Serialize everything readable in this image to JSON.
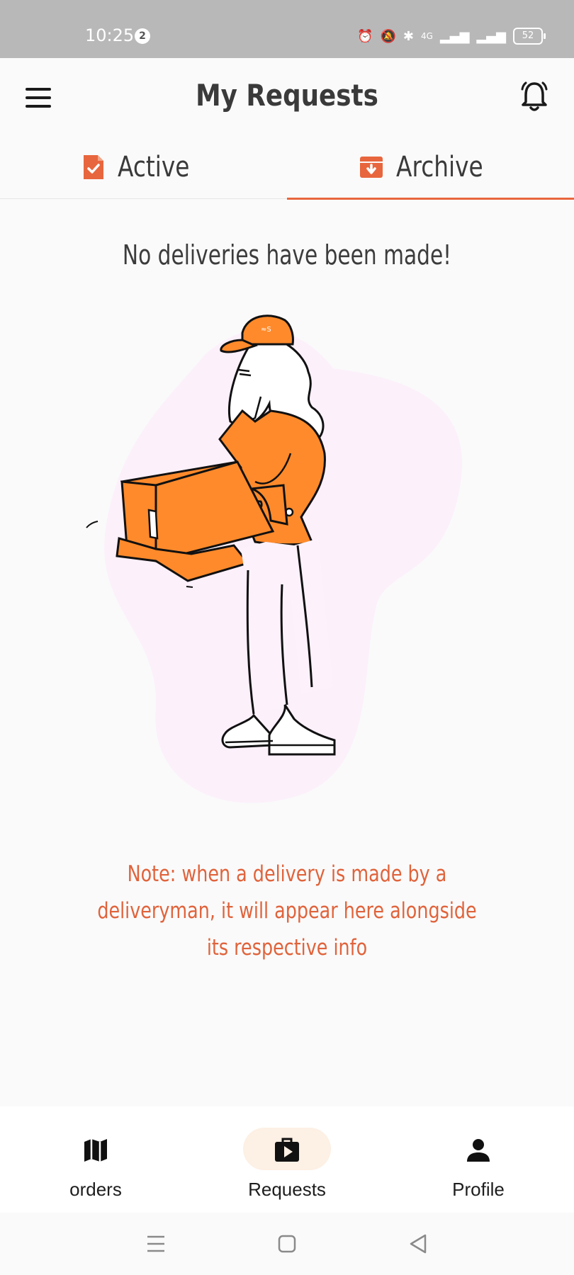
{
  "status_bar": {
    "time": "10:25",
    "notification_count": "2",
    "network": "4G",
    "battery": "52"
  },
  "header": {
    "title": "My Requests"
  },
  "tabs": [
    {
      "label": "Active",
      "selected": false
    },
    {
      "label": "Archive",
      "selected": true
    }
  ],
  "content": {
    "empty_message": "No deliveries have been made!",
    "note": "Note: when a delivery is made by a deliveryman, it will appear here alongside its respective info"
  },
  "bottom_nav": {
    "items": [
      {
        "label": "orders",
        "icon": "map-icon"
      },
      {
        "label": "Requests",
        "icon": "play-bag-icon",
        "selected": true
      },
      {
        "label": "Profile",
        "icon": "person-icon"
      }
    ]
  },
  "colors": {
    "accent": "#e8663d",
    "illustration_orange": "#ff8a2b",
    "blob": "#fcf0fb",
    "nav_pill": "#fdf0e4"
  }
}
